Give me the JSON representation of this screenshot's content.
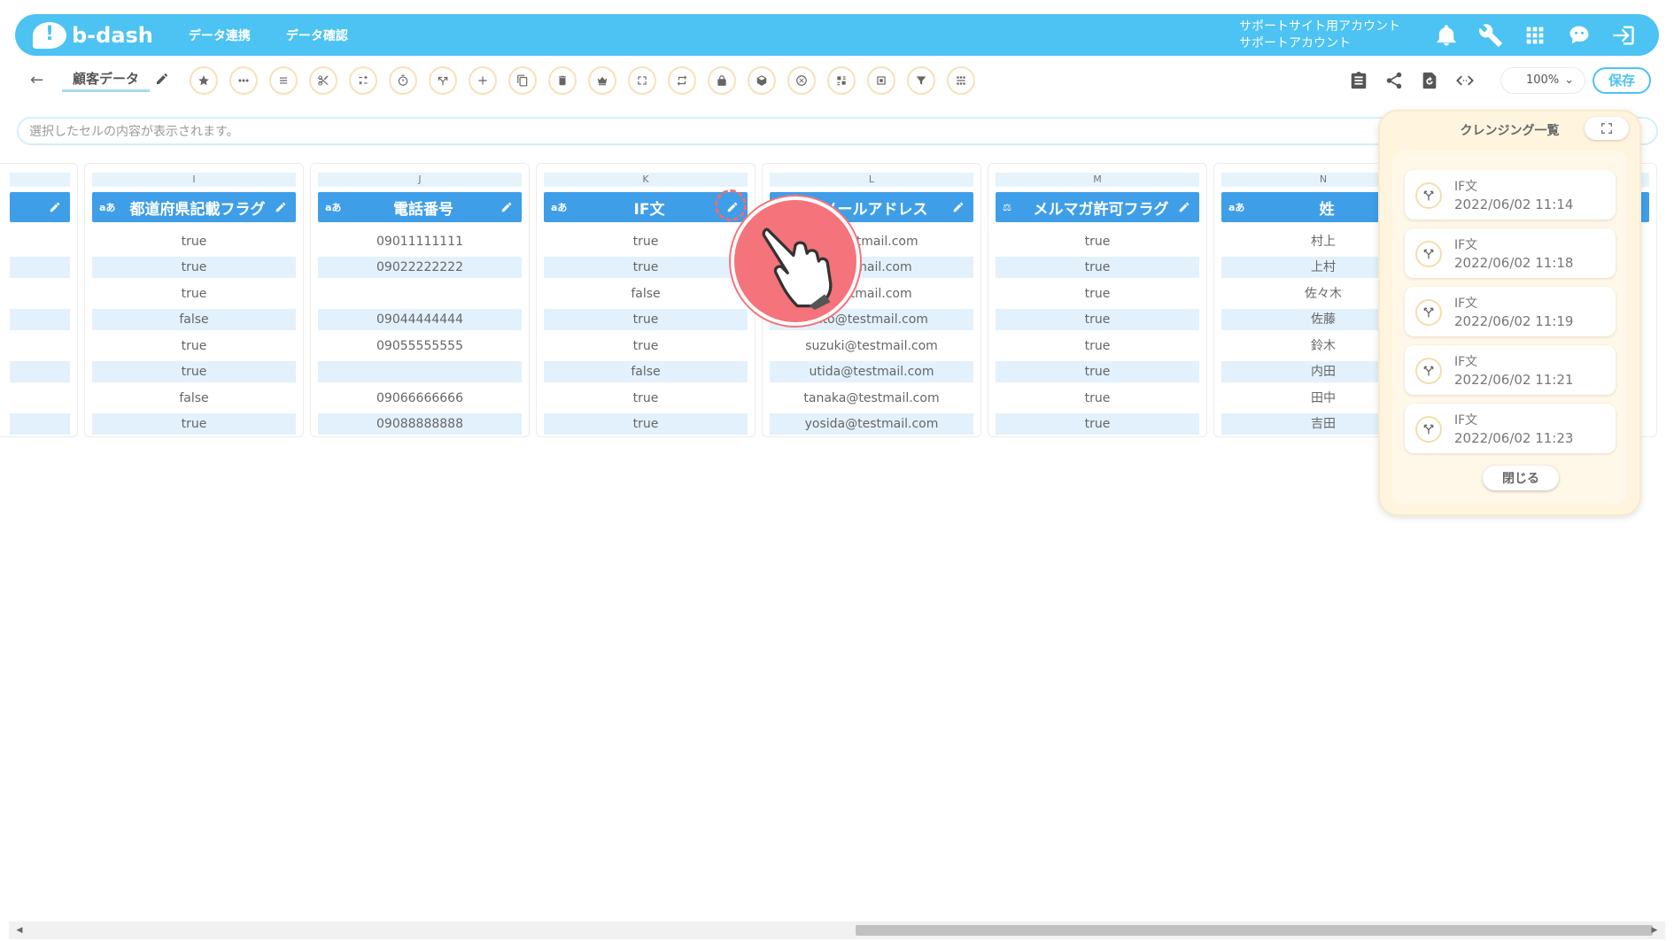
{
  "header": {
    "logo_text": "b-dash",
    "nav": [
      "データ連携",
      "データ確認"
    ],
    "account_line1": "サポートサイト用アカウント",
    "account_line2": "サポートアカウント",
    "icons": [
      "bell-icon",
      "wrench-icon",
      "grid-apps-icon",
      "robot-chat-icon",
      "logout-icon"
    ]
  },
  "toolbar": {
    "back_icon": "arrow-left-icon",
    "sheet_title": "顧客データ",
    "zoom": "100%",
    "save_label": "保存",
    "tools": [
      "star-icon",
      "more-icon",
      "text-lines-icon",
      "scissors-icon",
      "calc-icon",
      "timer-icon",
      "branch-icon",
      "plus-icon",
      "copy-icon",
      "trash-icon",
      "crown-icon",
      "expand-icon",
      "repeat-icon",
      "lock-icon",
      "package-icon",
      "clear-icon",
      "convert-icon",
      "box-icon",
      "filter-icon",
      "split-icon"
    ]
  },
  "cellbar": {
    "placeholder": "選択したセルの内容が表示されます。"
  },
  "columns": [
    {
      "letter": "I",
      "type": "aあ",
      "label": "都道府県記載フラグ",
      "cells": [
        "true",
        "true",
        "true",
        "false",
        "true",
        "true",
        "false",
        "true"
      ]
    },
    {
      "letter": "J",
      "type": "aあ",
      "label": "電話番号",
      "cells": [
        "09011111111",
        "09022222222",
        "",
        "09044444444",
        "09055555555",
        "",
        "09066666666",
        "09088888888"
      ]
    },
    {
      "letter": "K",
      "type": "aあ",
      "label": "IF文",
      "cells": [
        "true",
        "true",
        "false",
        "true",
        "true",
        "false",
        "true",
        "true"
      ]
    },
    {
      "letter": "L",
      "type": "aあ",
      "label": "メールアドレス",
      "cells": [
        "@testmail.com",
        "testmail.com",
        "testmail.com",
        "ato@testmail.com",
        "suzuki@testmail.com",
        "utida@testmail.com",
        "tanaka@testmail.com",
        "yosida@testmail.com"
      ]
    },
    {
      "letter": "M",
      "type": "⚖",
      "label": "メルマガ許可フラグ",
      "cells": [
        "true",
        "true",
        "true",
        "true",
        "true",
        "true",
        "true",
        "true"
      ]
    },
    {
      "letter": "N",
      "type": "aあ",
      "label": "姓",
      "cells": [
        "村上",
        "上村",
        "佐々木",
        "佐藤",
        "鈴木",
        "内田",
        "田中",
        "吉田"
      ]
    }
  ],
  "panel": {
    "title": "クレンジング一覧",
    "items": [
      {
        "name": "IF文",
        "date": "2022/06/02 11:14"
      },
      {
        "name": "IF文",
        "date": "2022/06/02 11:18"
      },
      {
        "name": "IF文",
        "date": "2022/06/02 11:19"
      },
      {
        "name": "IF文",
        "date": "2022/06/02 11:21"
      },
      {
        "name": "IF文",
        "date": "2022/06/02 11:23"
      }
    ],
    "close_label": "閉じる"
  }
}
